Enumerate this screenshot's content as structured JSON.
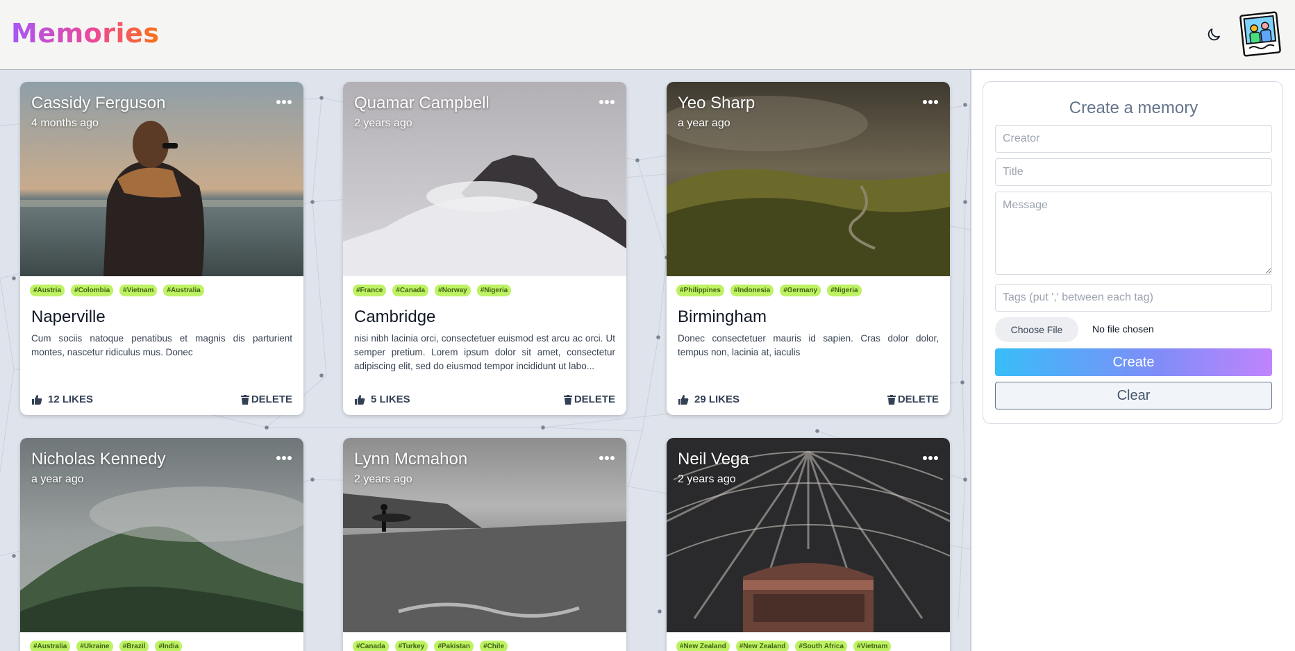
{
  "header": {
    "logo": "Memories",
    "theme_icon": "moon-icon",
    "avatar_icon": "memories-photo-avatar"
  },
  "colors": {
    "header_bg": "#f5f5f4",
    "page_bg": "#dfe4ec",
    "tag_bg": "#bef264",
    "tag_text": "#3f6212",
    "create_gradient": [
      "#38bdf8",
      "#818cf8",
      "#c084fc"
    ]
  },
  "posts": [
    {
      "creator": "Cassidy Ferguson",
      "time": "4 months ago",
      "tags": [
        "#Austria",
        "#Colombia",
        "#Vietnam",
        "#Australia"
      ],
      "title": "Naperville",
      "message": "Cum sociis natoque penatibus et magnis dis parturient montes, nascetur ridiculus mus. Donec",
      "likes": "12 LIKES",
      "delete": "DELETE",
      "image": "person-by-sea"
    },
    {
      "creator": "Quamar Campbell",
      "time": "2 years ago",
      "tags": [
        "#France",
        "#Canada",
        "#Norway",
        "#Nigeria"
      ],
      "title": "Cambridge",
      "message": "nisi nibh lacinia orci, consectetuer euismod est arcu ac orci. Ut semper pretium. Lorem ipsum dolor sit amet, consectetur adipiscing elit, sed do eiusmod tempor incididunt ut labo...",
      "likes": "5 LIKES",
      "delete": "DELETE",
      "image": "misty-mountain-peak"
    },
    {
      "creator": "Yeo Sharp",
      "time": "a year ago",
      "tags": [
        "#Philippines",
        "#Indonesia",
        "#Germany",
        "#Nigeria"
      ],
      "title": "Birmingham",
      "message": "Donec consectetuer mauris id sapien. Cras dolor dolor, tempus non, lacinia at, iaculis",
      "likes": "29 LIKES",
      "delete": "DELETE",
      "image": "foggy-hills-road"
    },
    {
      "creator": "Nicholas Kennedy",
      "time": "a year ago",
      "tags": [
        "#Australia",
        "#Ukraine",
        "#Brazil",
        "#India"
      ],
      "image": "forested-mountain-fog"
    },
    {
      "creator": "Lynn Mcmahon",
      "time": "2 years ago",
      "tags": [
        "#Canada",
        "#Turkey",
        "#Pakistan",
        "#Chile"
      ],
      "image": "surfer-on-beach"
    },
    {
      "creator": "Neil Vega",
      "time": "2 years ago",
      "tags": [
        "#New Zealand",
        "#New Zealand",
        "#South Africa",
        "#Vietnam"
      ],
      "image": "station-roof-arch"
    }
  ],
  "form": {
    "heading": "Create a memory",
    "creator_placeholder": "Creator",
    "title_placeholder": "Title",
    "message_placeholder": "Message",
    "tags_placeholder": "Tags (put ',' between each tag)",
    "file_button": "Choose File",
    "file_status": "No file chosen",
    "create_label": "Create",
    "clear_label": "Clear"
  }
}
